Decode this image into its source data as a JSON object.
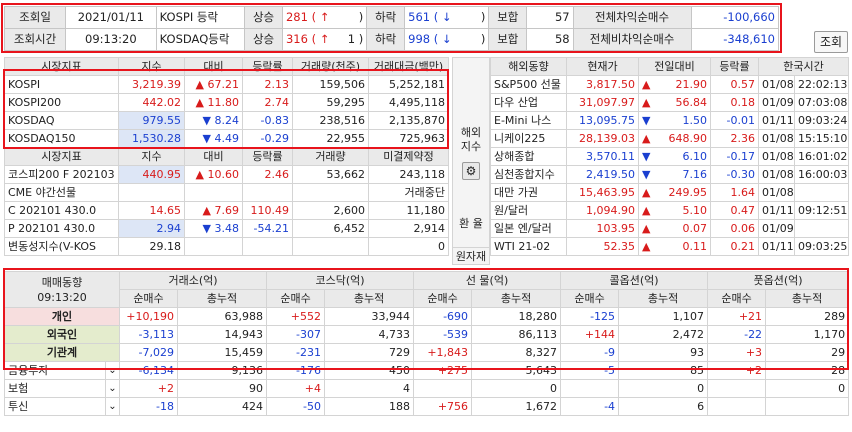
{
  "header": {
    "date_label": "조회일",
    "date_value": "2021/01/11",
    "time_label": "조회시간",
    "time_value": "09:13:20",
    "kospi_label": "KOSPI 등락",
    "kosdaq_label": "KOSDAQ등락",
    "up_label": "상승",
    "down_label": "하락",
    "flat_label": "보합",
    "kospi_up": "281 ( ↑",
    "kospi_up_limit": ")",
    "kospi_down": "561 ( ↓",
    "kospi_down_limit": ")",
    "kospi_flat": "57",
    "kosdaq_up": "316 ( ↑",
    "kosdaq_up_limit": "1 )",
    "kosdaq_down": "998 ( ↓",
    "kosdaq_down_limit": ")",
    "kosdaq_flat": "58",
    "arb_label": "전체차익순매수",
    "arb_value": "-100,660",
    "nonarb_label": "전체비차익순매수",
    "nonarb_value": "-348,610",
    "query_button": "조회"
  },
  "index_table": {
    "headers": [
      "시장지표",
      "지수",
      "대비",
      "등락률",
      "거래량(천주)",
      "거래대금(백만)"
    ],
    "rows": [
      {
        "name": "KOSPI",
        "value": "3,219.39",
        "arrow": "▲",
        "diff": "67.21",
        "rate": "2.13",
        "vol": "159,506",
        "amt": "5,252,181",
        "dir": "up"
      },
      {
        "name": "KOSPI200",
        "value": "442.02",
        "arrow": "▲",
        "diff": "11.80",
        "rate": "2.74",
        "vol": "59,295",
        "amt": "4,495,118",
        "dir": "up"
      },
      {
        "name": "KOSDAQ",
        "value": "979.55",
        "arrow": "▼",
        "diff": "8.24",
        "rate": "-0.83",
        "vol": "238,516",
        "amt": "2,135,870",
        "dir": "down"
      },
      {
        "name": "KOSDAQ150",
        "value": "1,530.28",
        "arrow": "▼",
        "diff": "4.49",
        "rate": "-0.29",
        "vol": "22,955",
        "amt": "725,963",
        "dir": "down"
      }
    ]
  },
  "deriv_table": {
    "headers": [
      "시장지표",
      "지수",
      "대비",
      "등락률",
      "거래량",
      "미결제약정"
    ],
    "rows": [
      {
        "name": "코스피200 F 202103",
        "value": "440.95",
        "arrow": "▲",
        "diff": "10.60",
        "rate": "2.46",
        "vol": "53,662",
        "oi": "243,118",
        "dir": "up",
        "bg": "blue"
      },
      {
        "name": "CME 야간선물",
        "value": "",
        "arrow": "",
        "diff": "",
        "rate": "",
        "vol": "",
        "oi": "거래중단",
        "dir": "none",
        "bg": ""
      },
      {
        "name": "C 202101 430.0",
        "value": "14.65",
        "arrow": "▲",
        "diff": "7.69",
        "rate": "110.49",
        "vol": "2,600",
        "oi": "11,180",
        "dir": "up",
        "bg": ""
      },
      {
        "name": "P 202101 430.0",
        "value": "2.94",
        "arrow": "▼",
        "diff": "3.48",
        "rate": "-54.21",
        "vol": "6,452",
        "oi": "2,914",
        "dir": "down",
        "bg": "blue"
      },
      {
        "name": "변동성지수(V-KOS",
        "value": "29.18",
        "arrow": "",
        "diff": "",
        "rate": "",
        "vol": "",
        "oi": "0",
        "dir": "none",
        "bg": ""
      }
    ]
  },
  "side_labels": {
    "overseas_top": "해외",
    "overseas_bottom": "지수",
    "fx_label": "환 율",
    "raw_label": "원자재"
  },
  "overseas_table": {
    "headers": [
      "해외동향",
      "현재가",
      "전일대비",
      "등락률",
      "한국시간"
    ],
    "rows": [
      {
        "name": "S&P500 선물",
        "price": "3,817.50",
        "arrow": "▲",
        "diff": "21.90",
        "rate": "0.57",
        "date": "01/08",
        "time": "22:02:13",
        "dir": "up"
      },
      {
        "name": "다우 산업",
        "price": "31,097.97",
        "arrow": "▲",
        "diff": "56.84",
        "rate": "0.18",
        "date": "01/09",
        "time": "07:03:08",
        "dir": "up"
      },
      {
        "name": "E-Mini 나스",
        "price": "13,095.75",
        "arrow": "▼",
        "diff": "1.50",
        "rate": "-0.01",
        "date": "01/11",
        "time": "09:03:24",
        "dir": "down"
      },
      {
        "name": "니케이225",
        "price": "28,139.03",
        "arrow": "▲",
        "diff": "648.90",
        "rate": "2.36",
        "date": "01/08",
        "time": "15:15:10",
        "dir": "up"
      },
      {
        "name": "상해종합",
        "price": "3,570.11",
        "arrow": "▼",
        "diff": "6.10",
        "rate": "-0.17",
        "date": "01/08",
        "time": "16:01:02",
        "dir": "down"
      },
      {
        "name": "심천종합지수",
        "price": "2,419.50",
        "arrow": "▼",
        "diff": "7.16",
        "rate": "-0.30",
        "date": "01/08",
        "time": "16:00:03",
        "dir": "down"
      },
      {
        "name": "대만 가권",
        "price": "15,463.95",
        "arrow": "▲",
        "diff": "249.95",
        "rate": "1.64",
        "date": "01/08",
        "time": "",
        "dir": "up"
      },
      {
        "name": "원/달러",
        "price": "1,094.90",
        "arrow": "▲",
        "diff": "5.10",
        "rate": "0.47",
        "date": "01/11",
        "time": "09:12:51",
        "dir": "up"
      },
      {
        "name": "일본 엔/달러",
        "price": "103.95",
        "arrow": "▲",
        "diff": "0.07",
        "rate": "0.06",
        "date": "01/09",
        "time": "",
        "dir": "up"
      },
      {
        "name": "WTI 21-02",
        "price": "52.35",
        "arrow": "▲",
        "diff": "0.11",
        "rate": "0.21",
        "date": "01/11",
        "time": "09:03:25",
        "dir": "up"
      }
    ]
  },
  "trade_table": {
    "title": "매매동향",
    "time": "09:13:20",
    "groups": [
      "거래소(억)",
      "코스닥(억)",
      "선 물(억)",
      "콜옵션(억)",
      "풋옵션(억)"
    ],
    "sub_headers": [
      "순매수",
      "총누적"
    ],
    "rows": [
      {
        "name": "개인",
        "bg": "pink",
        "cells": [
          "+10,190",
          "63,988",
          "+552",
          "33,944",
          "-690",
          "18,280",
          "-125",
          "1,107",
          "+21",
          "289"
        ]
      },
      {
        "name": "외국인",
        "bg": "green",
        "cells": [
          "-3,113",
          "14,943",
          "-307",
          "4,733",
          "-539",
          "86,113",
          "+144",
          "2,472",
          "-22",
          "1,170"
        ]
      },
      {
        "name": "기관계",
        "bg": "green",
        "cells": [
          "-7,029",
          "15,459",
          "-231",
          "729",
          "+1,843",
          "8,327",
          "-9",
          "93",
          "+3",
          "29"
        ]
      },
      {
        "name": "금융투자",
        "bg": "",
        "cells": [
          "-6,134",
          "9,136",
          "-176",
          "450",
          "+275",
          "5,643",
          "-5",
          "85",
          "+2",
          "28"
        ]
      },
      {
        "name": "보험",
        "bg": "",
        "cells": [
          "+2",
          "90",
          "+4",
          "4",
          "",
          "0",
          "",
          "0",
          "",
          "0"
        ]
      },
      {
        "name": "투신",
        "bg": "",
        "cells": [
          "-18",
          "424",
          "-50",
          "188",
          "+756",
          "1,672",
          "-4",
          "6",
          "",
          ""
        ]
      }
    ]
  },
  "colors": {
    "up": "#d81b1b",
    "down": "#1a3fd0",
    "highlight": "#e8141c"
  }
}
